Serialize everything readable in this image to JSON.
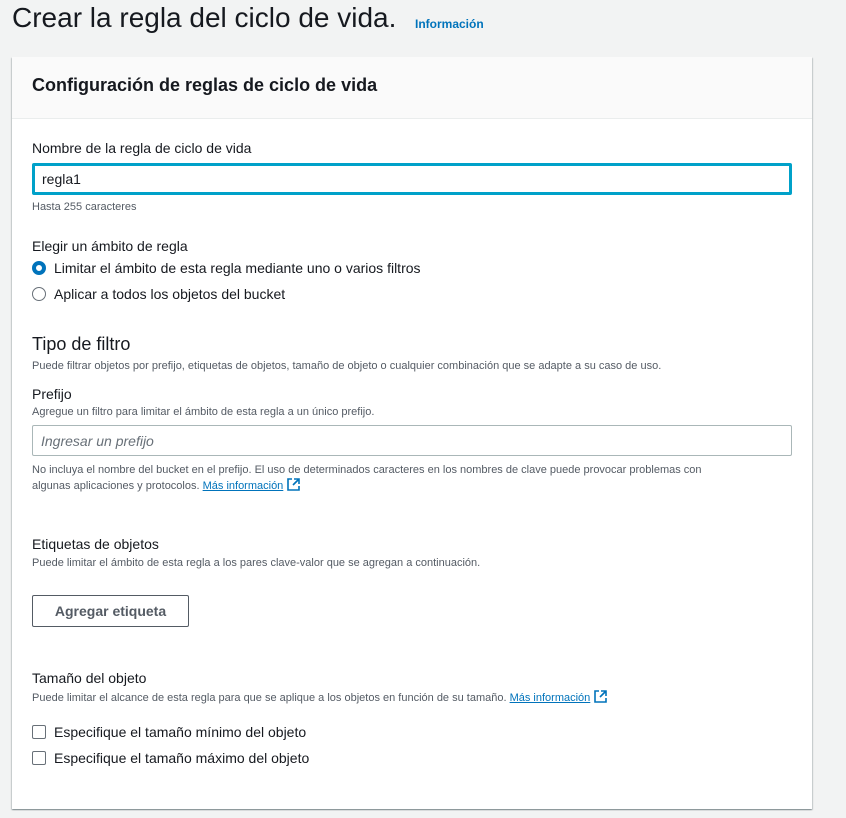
{
  "page": {
    "title": "Crear la regla del ciclo de vida.",
    "info_link": "Información"
  },
  "panel": {
    "title": "Configuración de reglas de ciclo de vida"
  },
  "rule_name": {
    "label": "Nombre de la regla de ciclo de vida",
    "value": "regla1",
    "hint": "Hasta 255 caracteres"
  },
  "scope": {
    "label": "Elegir un ámbito de regla",
    "options": [
      {
        "label": "Limitar el ámbito de esta regla mediante uno o varios filtros",
        "selected": true
      },
      {
        "label": "Aplicar a todos los objetos del bucket",
        "selected": false
      }
    ]
  },
  "filter_type": {
    "title": "Tipo de filtro",
    "description": "Puede filtrar objetos por prefijo, etiquetas de objetos, tamaño de objeto o cualquier combinación que se adapte a su caso de uso."
  },
  "prefix": {
    "label": "Prefijo",
    "description": "Agregue un filtro para limitar el ámbito de esta regla a un único prefijo.",
    "placeholder": "Ingresar un prefijo",
    "value": "",
    "warning_line1": "No incluya el nombre del bucket en el prefijo. El uso de determinados caracteres en los nombres de clave puede provocar problemas con",
    "warning_line2": "algunas aplicaciones y protocolos.",
    "more_info": "Más información"
  },
  "tags": {
    "label": "Etiquetas de objetos",
    "description": "Puede limitar el ámbito de esta regla a los pares clave-valor que se agregan a continuación.",
    "add_button": "Agregar etiqueta"
  },
  "size": {
    "label": "Tamaño del objeto",
    "description": "Puede limitar el alcance de esta regla para que se aplique a los objetos en función de su tamaño.",
    "more_info": "Más información",
    "options": [
      {
        "label": "Especifique el tamaño mínimo del objeto",
        "checked": false
      },
      {
        "label": "Especifique el tamaño máximo del objeto",
        "checked": false
      }
    ]
  },
  "colors": {
    "accent": "#0073bb",
    "focus": "#00a1c9",
    "background": "#f2f3f3"
  },
  "icons": [
    "external-link-icon"
  ]
}
